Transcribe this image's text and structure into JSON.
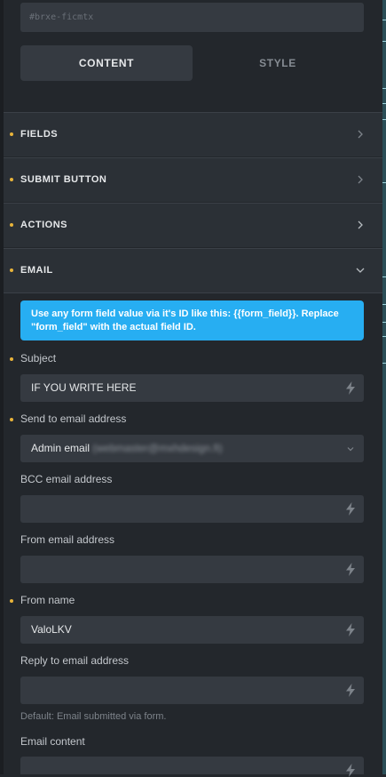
{
  "element_id": "#brxe-ficmtx",
  "tabs": {
    "content": "CONTENT",
    "style": "STYLE"
  },
  "sections": [
    {
      "label": "FIELDS"
    },
    {
      "label": "SUBMIT BUTTON"
    },
    {
      "label": "ACTIONS"
    },
    {
      "label": "EMAIL"
    }
  ],
  "info_text": "Use any form field value via it's ID like this: {{form_field}}. Replace \"form_field\" with the actual field ID.",
  "fields": {
    "subject": {
      "label": "Subject",
      "value": "IF YOU WRITE HERE"
    },
    "send_to": {
      "label": "Send to email address",
      "value": "Admin email",
      "value_detail": "(webmaster@mxhdesign.fi)"
    },
    "bcc": {
      "label": "BCC email address",
      "value": ""
    },
    "from_email": {
      "label": "From email address",
      "value": ""
    },
    "from_name": {
      "label": "From name",
      "value": "ValoLKV"
    },
    "reply_to": {
      "label": "Reply to email address",
      "value": "",
      "hint": "Default: Email submitted via form."
    },
    "email_content": {
      "label": "Email content",
      "value": ""
    }
  },
  "icons": {
    "dynamic_data": "bolt-icon",
    "expand": "chevron-right-icon",
    "collapse": "chevron-down-icon",
    "select": "chevron-down-icon"
  },
  "colors": {
    "accent": "#27aef2",
    "required_dot": "#e8b33a",
    "panel": "#23272c",
    "section": "#2b3036",
    "input": "#353a41"
  }
}
